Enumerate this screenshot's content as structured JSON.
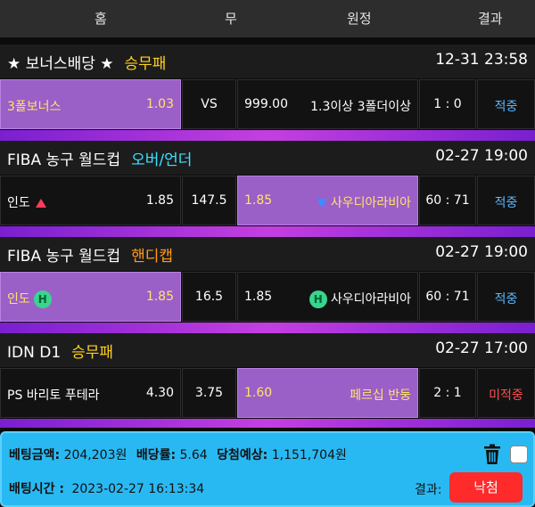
{
  "header": {
    "home": "홈",
    "draw": "무",
    "away": "원정",
    "result": "결과"
  },
  "colors": {
    "highlight": "#9b5fc8",
    "odds_yellow": "#ffe36a",
    "win_blue": "#5ab8ff",
    "lose_red": "#ff4d4d",
    "footer_blue": "#29b9f2"
  },
  "games": [
    {
      "league": "★ 보너스배당 ★",
      "kind": "승무패",
      "kind_color": "#ffd21f",
      "datetime": "12-31 23:58",
      "home": "3폴보너스",
      "home_odds": "1.03",
      "mid": "VS",
      "away_odds": "999.00",
      "away": "1.3이상 3폴더이상",
      "score": "1 : 0",
      "status": "적중"
    },
    {
      "league": "FIBA 농구 월드컵",
      "kind": "오버/언더",
      "kind_color": "#3ee0ff",
      "datetime": "02-27 19:00",
      "home": "인도",
      "home_odds": "1.85",
      "mid": "147.5",
      "away_odds": "1.85",
      "away": "사우디아라비아",
      "score": "60 : 71",
      "status": "적중"
    },
    {
      "league": "FIBA 농구 월드컵",
      "kind": "핸디캡",
      "kind_color": "#ff9a1f",
      "datetime": "02-27 19:00",
      "home": "인도",
      "home_odds": "1.85",
      "mid": "16.5",
      "away_odds": "1.85",
      "away": "사우디아라비아",
      "score": "60 : 71",
      "status": "적중",
      "badge": "H"
    },
    {
      "league": "IDN D1",
      "kind": "승무패",
      "kind_color": "#ffd21f",
      "datetime": "02-27 17:00",
      "home": "PS 바리토 푸테라",
      "home_odds": "4.30",
      "mid": "3.75",
      "away_odds": "1.60",
      "away": "페르십 반둥",
      "score": "2 : 1",
      "status": "미적중"
    }
  ],
  "footer": {
    "bet_amount_label": "베팅금액:",
    "bet_amount": "204,203원",
    "odds_label": "배당률:",
    "odds": "5.64",
    "expected_label": "당첨예상:",
    "expected": "1,151,704원",
    "bet_time_label": "배팅시간 :",
    "bet_time": "2023-02-27 16:13:34",
    "result_label": "결과:",
    "result_button": "낙첨"
  }
}
